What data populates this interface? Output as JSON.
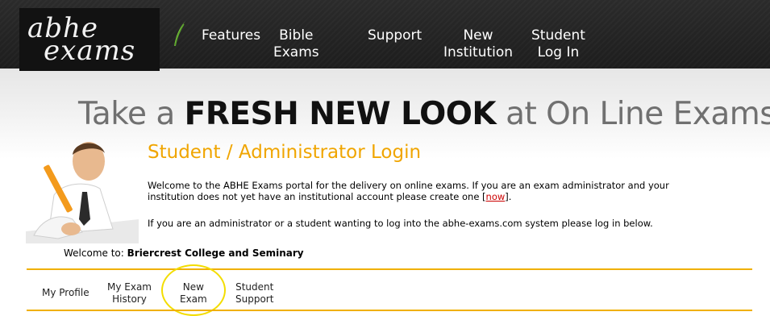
{
  "header": {
    "logo": {
      "line1": "abhe",
      "line2": "exams"
    },
    "nav": [
      {
        "line1": "Features",
        "line2": ""
      },
      {
        "line1": "Bible",
        "line2": "Exams"
      },
      {
        "line1": "Support",
        "line2": ""
      },
      {
        "line1": "New",
        "line2": "Institution"
      },
      {
        "line1": "Student",
        "line2": "Log In"
      }
    ]
  },
  "banner": {
    "tagline_prefix": "Take a",
    "tagline_bold": "FRESH NEW LOOK",
    "tagline_suffix": "at On Line Exams"
  },
  "login": {
    "heading": "Student / Administrator Login",
    "intro_text": "Welcome to the ABHE Exams portal for the delivery on online exams. If you are an exam administrator and your institution does not yet have an institutional account please create one [",
    "intro_link": "now",
    "intro_end": "].",
    "intro_2": "If you are an administrator or a student wanting to log into the abhe-exams.com system please log in below."
  },
  "welcome": {
    "label": "Welcome to:",
    "institution": "Briercrest College and Seminary"
  },
  "tabs": [
    {
      "line1": "My Profile",
      "line2": ""
    },
    {
      "line1": "My Exam",
      "line2": "History"
    },
    {
      "line1": "New",
      "line2": "Exam"
    },
    {
      "line1": "Student",
      "line2": "Support"
    }
  ],
  "colors": {
    "accent": "#f0a500",
    "highlight": "#f3dd00",
    "header_bg": "#222222"
  }
}
